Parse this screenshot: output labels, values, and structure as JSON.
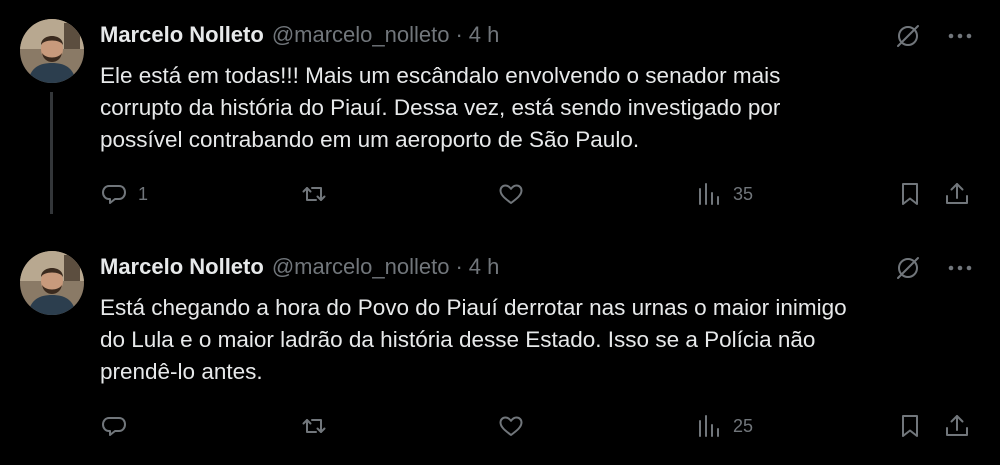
{
  "tweets": [
    {
      "author": {
        "name": "Marcelo Nolleto",
        "handle": "@marcelo_nolleto"
      },
      "separator": "·",
      "time": "4 h",
      "text": "Ele está em todas!!! Mais um escândalo envolvendo o senador mais\ncorrupto da história do Piauí. Dessa vez, está sendo investigado por\npossível contrabando em um aeroporto de São Paulo.",
      "stats": {
        "replies": "1",
        "retweets": "",
        "likes": "",
        "views": "35"
      }
    },
    {
      "author": {
        "name": "Marcelo Nolleto",
        "handle": "@marcelo_nolleto"
      },
      "separator": "·",
      "time": "4 h",
      "text": "Está chegando a hora do Povo do Piauí derrotar nas urnas o maior inimigo\ndo Lula e o maior ladrão da história desse Estado. Isso se a Polícia não\nprendê-lo antes.",
      "stats": {
        "replies": "",
        "retweets": "",
        "likes": "",
        "views": "25"
      }
    }
  ],
  "icons": {
    "avatar": "avatar-photo",
    "grok": "grok-slash-circle-icon",
    "more": "more-dots-icon",
    "reply": "reply-bubble-icon",
    "retweet": "retweet-arrows-icon",
    "like": "heart-icon",
    "views": "analytics-bars-icon",
    "bookmark": "bookmark-icon",
    "share": "share-upload-icon"
  },
  "colors": {
    "background": "#000000",
    "text": "#e7e9ea",
    "secondary": "#71767b",
    "thread_line": "#333639"
  }
}
